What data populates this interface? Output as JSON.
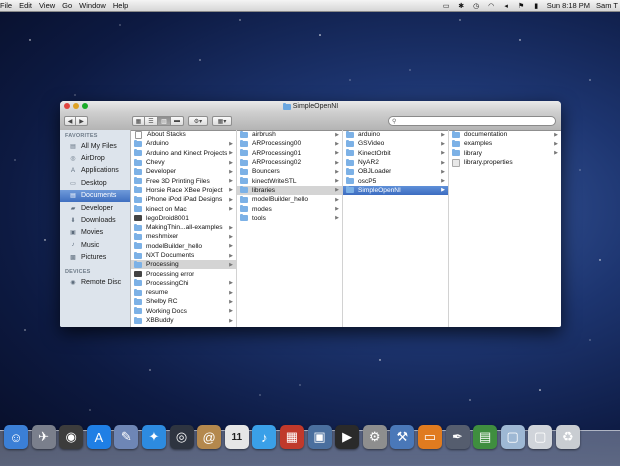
{
  "menubar": {
    "items": [
      "File",
      "Edit",
      "View",
      "Go",
      "Window",
      "Help"
    ],
    "status": {
      "datetime": "Sun 8:18 PM",
      "user": "Sam T"
    }
  },
  "window": {
    "title": "SimpleOpenNI",
    "search": {
      "value": "",
      "placeholder": ""
    }
  },
  "sidebar": {
    "favorites_header": "FAVORITES",
    "favorites": [
      {
        "label": "All My Files",
        "icon": "all-files-icon"
      },
      {
        "label": "AirDrop",
        "icon": "airdrop-icon"
      },
      {
        "label": "Applications",
        "icon": "applications-icon"
      },
      {
        "label": "Desktop",
        "icon": "desktop-icon"
      },
      {
        "label": "Documents",
        "icon": "documents-icon",
        "selected": true
      },
      {
        "label": "Developer",
        "icon": "folder-icon"
      },
      {
        "label": "Downloads",
        "icon": "downloads-icon"
      },
      {
        "label": "Movies",
        "icon": "movies-icon"
      },
      {
        "label": "Music",
        "icon": "music-icon"
      },
      {
        "label": "Pictures",
        "icon": "pictures-icon"
      }
    ],
    "devices_header": "DEVICES",
    "devices": [
      {
        "label": "Remote Disc",
        "icon": "remote-disc-icon"
      }
    ]
  },
  "columns": [
    {
      "items": [
        {
          "label": "About Stacks",
          "kind": "file"
        },
        {
          "label": "Arduino",
          "kind": "folder",
          "chev": true
        },
        {
          "label": "Arduino and Kinect Projects",
          "kind": "folder",
          "chev": true
        },
        {
          "label": "Chevy",
          "kind": "folder",
          "chev": true
        },
        {
          "label": "Developer",
          "kind": "folder",
          "chev": true
        },
        {
          "label": "Free 3D Printing Files",
          "kind": "folder",
          "chev": true
        },
        {
          "label": "Horsie Race XBee Project",
          "kind": "folder",
          "chev": true
        },
        {
          "label": "iPhone iPod iPad Designs",
          "kind": "folder",
          "chev": true
        },
        {
          "label": "kinect on Mac",
          "kind": "folder",
          "chev": true
        },
        {
          "label": "legoDroid8001",
          "kind": "app"
        },
        {
          "label": "MakingThin...all-examples",
          "kind": "folder",
          "chev": true
        },
        {
          "label": "meshmixer",
          "kind": "folder",
          "chev": true
        },
        {
          "label": "modelBuilder_hello",
          "kind": "folder",
          "chev": true
        },
        {
          "label": "NXT Documents",
          "kind": "folder",
          "chev": true
        },
        {
          "label": "Processing",
          "kind": "folder",
          "chev": true,
          "selected": "inactive"
        },
        {
          "label": "Processing error",
          "kind": "app"
        },
        {
          "label": "ProcessingChi",
          "kind": "folder",
          "chev": true
        },
        {
          "label": "resume",
          "kind": "folder",
          "chev": true
        },
        {
          "label": "Shelby RC",
          "kind": "folder",
          "chev": true
        },
        {
          "label": "Working Docs",
          "kind": "folder",
          "chev": true
        },
        {
          "label": "XBBuddy",
          "kind": "folder",
          "chev": true
        }
      ]
    },
    {
      "items": [
        {
          "label": "airbrush",
          "kind": "folder",
          "chev": true
        },
        {
          "label": "ARProcessing00",
          "kind": "folder",
          "chev": true
        },
        {
          "label": "ARProcessing01",
          "kind": "folder",
          "chev": true
        },
        {
          "label": "ARProcessing02",
          "kind": "folder",
          "chev": true
        },
        {
          "label": "Bouncers",
          "kind": "folder",
          "chev": true
        },
        {
          "label": "kinectWriteSTL",
          "kind": "folder",
          "chev": true
        },
        {
          "label": "libraries",
          "kind": "folder",
          "chev": true,
          "selected": "inactive"
        },
        {
          "label": "modelBuilder_hello",
          "kind": "folder",
          "chev": true
        },
        {
          "label": "modes",
          "kind": "folder",
          "chev": true
        },
        {
          "label": "tools",
          "kind": "folder",
          "chev": true
        }
      ]
    },
    {
      "items": [
        {
          "label": "arduino",
          "kind": "folder",
          "chev": true
        },
        {
          "label": "GSVideo",
          "kind": "folder",
          "chev": true
        },
        {
          "label": "KinectOrbit",
          "kind": "folder",
          "chev": true
        },
        {
          "label": "NyAR2",
          "kind": "folder",
          "chev": true
        },
        {
          "label": "OBJLoader",
          "kind": "folder",
          "chev": true
        },
        {
          "label": "oscP5",
          "kind": "folder",
          "chev": true
        },
        {
          "label": "SimpleOpenNI",
          "kind": "folder",
          "chev": true,
          "selected": "active"
        }
      ]
    },
    {
      "items": [
        {
          "label": "documentation",
          "kind": "folder",
          "chev": true
        },
        {
          "label": "examples",
          "kind": "folder",
          "chev": true
        },
        {
          "label": "library",
          "kind": "folder",
          "chev": true
        },
        {
          "label": "library.properties",
          "kind": "doc"
        }
      ]
    }
  ],
  "dock": {
    "items": [
      {
        "name": "finder",
        "glyph": "☺",
        "color": "#3b7fd6"
      },
      {
        "name": "launchpad",
        "glyph": "✈",
        "color": "#7a7f8c"
      },
      {
        "name": "dashboard",
        "glyph": "◉",
        "color": "#3c3c3c"
      },
      {
        "name": "app-store",
        "glyph": "A",
        "color": "#1f7fe5"
      },
      {
        "name": "preview",
        "glyph": "✎",
        "color": "#6e86b5"
      },
      {
        "name": "safari",
        "glyph": "✦",
        "color": "#2d8be0"
      },
      {
        "name": "photo-booth",
        "glyph": "◎",
        "color": "#2e3440"
      },
      {
        "name": "contacts",
        "glyph": "@",
        "color": "#b4884d"
      },
      {
        "name": "calendar",
        "glyph": "11",
        "color": "#e6e6e6"
      },
      {
        "name": "itunes",
        "glyph": "♪",
        "color": "#3aa0e8"
      },
      {
        "name": "photo-app",
        "glyph": "▦",
        "color": "#c0392b"
      },
      {
        "name": "iphoto",
        "glyph": "▣",
        "color": "#4a6f9e"
      },
      {
        "name": "terminal",
        "glyph": "▶",
        "color": "#2a2a2a"
      },
      {
        "name": "system-preferences",
        "glyph": "⚙",
        "color": "#8e8e8e"
      },
      {
        "name": "xcode",
        "glyph": "⚒",
        "color": "#4a78b8"
      },
      {
        "name": "keynote",
        "glyph": "▭",
        "color": "#e07b1f"
      },
      {
        "name": "grapher",
        "glyph": "✒",
        "color": "#555d6e"
      },
      {
        "name": "activity-monitor",
        "glyph": "▤",
        "color": "#3f8e3f"
      },
      {
        "name": "documents-stack",
        "glyph": "▢",
        "color": "#9eb8d4"
      },
      {
        "name": "downloads-stack",
        "glyph": "▢",
        "color": "#d0d4da"
      },
      {
        "name": "trash",
        "glyph": "♻",
        "color": "#c9cdd2"
      }
    ]
  }
}
